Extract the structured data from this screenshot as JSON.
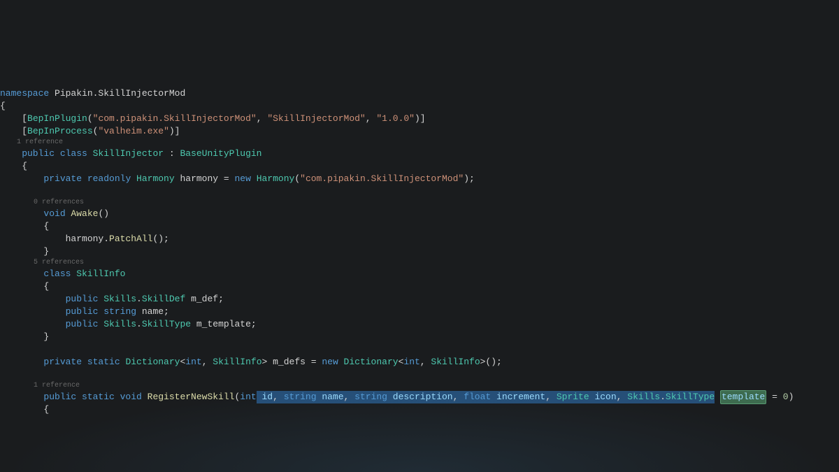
{
  "code": {
    "namespace_kw": "namespace",
    "namespace_name": " Pipakin.SkillInjectorMod",
    "brace_open": "{",
    "brace_close": "}",
    "attr1_open": "    [",
    "attr1_name": "BepInPlugin",
    "attr1_p1": "(",
    "attr1_s1": "\"com.pipakin.SkillInjectorMod\"",
    "attr1_c1": ", ",
    "attr1_s2": "\"SkillInjectorMod\"",
    "attr1_c2": ", ",
    "attr1_s3": "\"1.0.0\"",
    "attr1_close": ")]",
    "attr2_open": "    [",
    "attr2_name": "BepInProcess",
    "attr2_p1": "(",
    "attr2_s1": "\"valheim.exe\"",
    "attr2_close": ")]",
    "ref1": "    1 reference",
    "class1_public": "    public",
    "class1_class": " class",
    "class1_name": " SkillInjector",
    "class1_colon": " : ",
    "class1_base": "BaseUnityPlugin",
    "class1_brace": "    {",
    "field1_private": "        private",
    "field1_readonly": " readonly",
    "field1_type": " Harmony",
    "field1_name": " harmony",
    "field1_eq": " = ",
    "field1_new": "new",
    "field1_ctor": " Harmony",
    "field1_p1": "(",
    "field1_s1": "\"com.pipakin.SkillInjectorMod\"",
    "field1_close": ");",
    "ref0": "        0 references",
    "awake_void": "        void",
    "awake_name": " Awake",
    "awake_parens": "()",
    "awake_brace_o": "        {",
    "awake_body1": "            harmony.",
    "awake_body2": "PatchAll",
    "awake_body3": "();",
    "awake_brace_c": "        }",
    "ref5": "        5 references",
    "si_class": "        class",
    "si_name": " SkillInfo",
    "si_brace_o": "        {",
    "si_f1_public": "            public",
    "si_f1_type": " Skills",
    "si_f1_dot": ".",
    "si_f1_type2": "SkillDef",
    "si_f1_name": " m_def;",
    "si_f2_public": "            public",
    "si_f2_type": " string",
    "si_f2_name": " name;",
    "si_f3_public": "            public",
    "si_f3_type": " Skills",
    "si_f3_dot": ".",
    "si_f3_type2": "SkillType",
    "si_f3_name": " m_template;",
    "si_brace_c": "        }",
    "dict_private": "        private",
    "dict_static": " static",
    "dict_type": " Dictionary",
    "dict_lt": "<",
    "dict_int": "int",
    "dict_c1": ", ",
    "dict_si": "SkillInfo",
    "dict_gt": ">",
    "dict_name": " m_defs",
    "dict_eq": " = ",
    "dict_new": "new",
    "dict_type2": " Dictionary",
    "dict_lt2": "<",
    "dict_int2": "int",
    "dict_c2": ", ",
    "dict_si2": "SkillInfo",
    "dict_gt2": ">();",
    "ref1b": "        1 reference",
    "reg_public": "        public",
    "reg_static": " static",
    "reg_void": " void",
    "reg_name": " RegisterNewSkill",
    "reg_p1": "(",
    "reg_int": "int",
    "reg_sp": " ",
    "reg_id": "id",
    "reg_c1": ", ",
    "reg_string": "string",
    "reg_pname": " name",
    "reg_c2": ", ",
    "reg_string2": "string",
    "reg_desc": " description",
    "reg_c3": ", ",
    "reg_float": "float",
    "reg_inc": " increment",
    "reg_c4": ", ",
    "reg_sprite": "Sprite",
    "reg_icon": " icon",
    "reg_c5": ", ",
    "reg_skills": "Skills",
    "reg_dot": ".",
    "reg_st": "SkillType",
    "reg_tmpl": "template",
    "reg_eq": " = ",
    "reg_zero": "0",
    "reg_close": ")",
    "reg_brace": "        {"
  }
}
